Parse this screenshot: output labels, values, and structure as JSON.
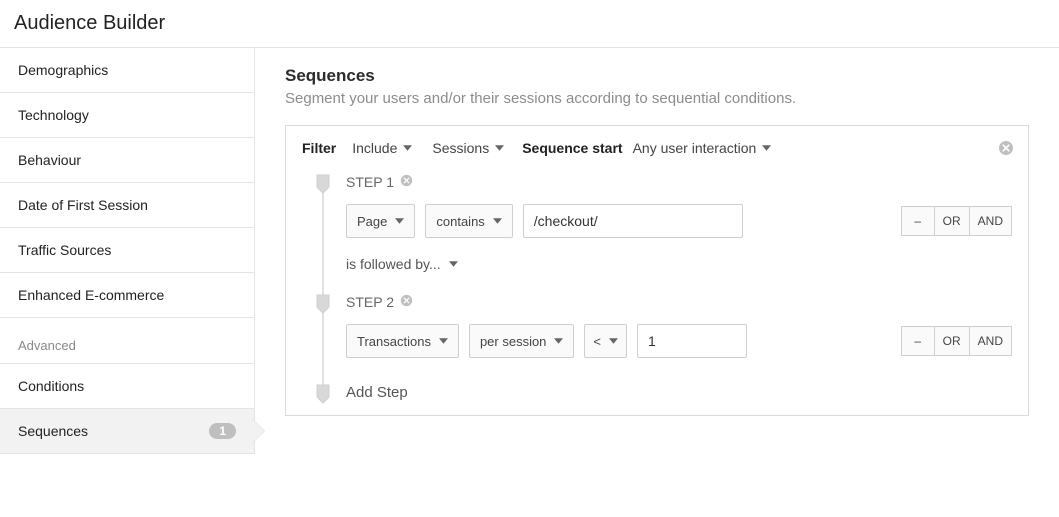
{
  "title": "Audience Builder",
  "sidebar": {
    "items": [
      {
        "label": "Demographics"
      },
      {
        "label": "Technology"
      },
      {
        "label": "Behaviour"
      },
      {
        "label": "Date of First Session"
      },
      {
        "label": "Traffic Sources"
      },
      {
        "label": "Enhanced E-commerce"
      }
    ],
    "advanced_group": "Advanced",
    "advanced_items": [
      {
        "label": "Conditions"
      },
      {
        "label": "Sequences",
        "count": "1",
        "active": true
      }
    ]
  },
  "section": {
    "heading": "Sequences",
    "sub": "Segment your users and/or their sessions according to sequential conditions."
  },
  "filter": {
    "label": "Filter",
    "include": "Include",
    "scope": "Sessions",
    "seq_start_label": "Sequence start",
    "seq_start_value": "Any user interaction"
  },
  "steps": {
    "step1": {
      "title": "STEP 1",
      "dimension": "Page",
      "match": "contains",
      "value": "/checkout/"
    },
    "connector": "is followed by...",
    "step2": {
      "title": "STEP 2",
      "metric": "Transactions",
      "per": "per session",
      "op": "<",
      "value": "1"
    },
    "add": "Add Step"
  },
  "ops": {
    "minus": "–",
    "or": "OR",
    "and": "AND"
  }
}
